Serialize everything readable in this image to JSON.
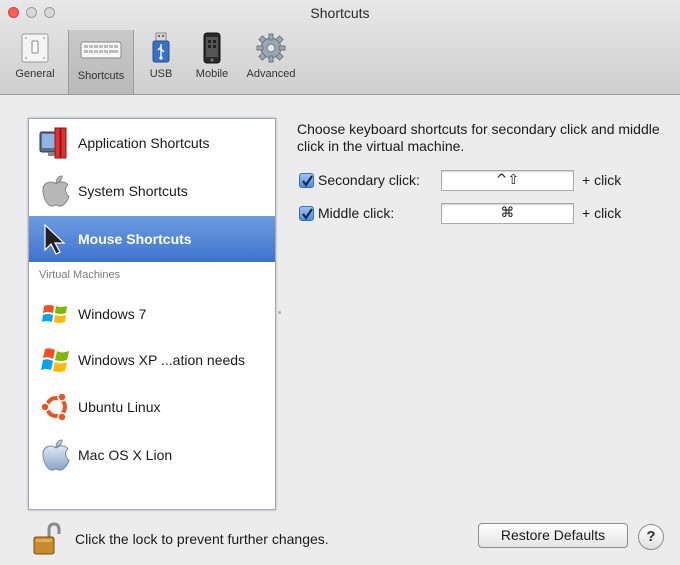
{
  "window": {
    "title": "Shortcuts"
  },
  "toolbar": {
    "items": [
      {
        "label": "General",
        "icon": "general-switch-icon"
      },
      {
        "label": "Shortcuts",
        "icon": "keyboard-icon"
      },
      {
        "label": "USB",
        "icon": "usb-icon"
      },
      {
        "label": "Mobile",
        "icon": "mobile-phone-icon"
      },
      {
        "label": "Advanced",
        "icon": "gear-icon"
      }
    ],
    "selected": "Shortcuts"
  },
  "sidebar": {
    "items": [
      {
        "label": "Application Shortcuts",
        "icon": "application-shortcuts-icon"
      },
      {
        "label": "System Shortcuts",
        "icon": "apple-logo-icon"
      },
      {
        "label": "Mouse Shortcuts",
        "icon": "mouse-pointer-icon",
        "selected": true
      }
    ],
    "section_header": "Virtual Machines",
    "vms": [
      {
        "label": "Windows 7",
        "icon": "windows-7-icon"
      },
      {
        "label": "Windows XP ...ation needs",
        "icon": "windows-xp-icon"
      },
      {
        "label": "Ubuntu Linux",
        "icon": "ubuntu-icon"
      },
      {
        "label": "Mac OS X Lion",
        "icon": "apple-logo-icon"
      }
    ]
  },
  "main": {
    "description": "Choose keyboard shortcuts for secondary click and middle click in the virtual machine.",
    "options": [
      {
        "label": "Secondary click:",
        "checked": true,
        "shortcut": "^⇧",
        "suffix": "+ click"
      },
      {
        "label": "Middle click:",
        "checked": true,
        "shortcut": "⌘",
        "suffix": "+ click"
      }
    ]
  },
  "footer": {
    "lock_text": "Click the lock to prevent further changes.",
    "restore_label": "Restore Defaults",
    "help_label": "?"
  },
  "colors": {
    "selection": "#3f74cf",
    "checkbox": "#4f8fe2",
    "close_button": "#fd5c57"
  }
}
